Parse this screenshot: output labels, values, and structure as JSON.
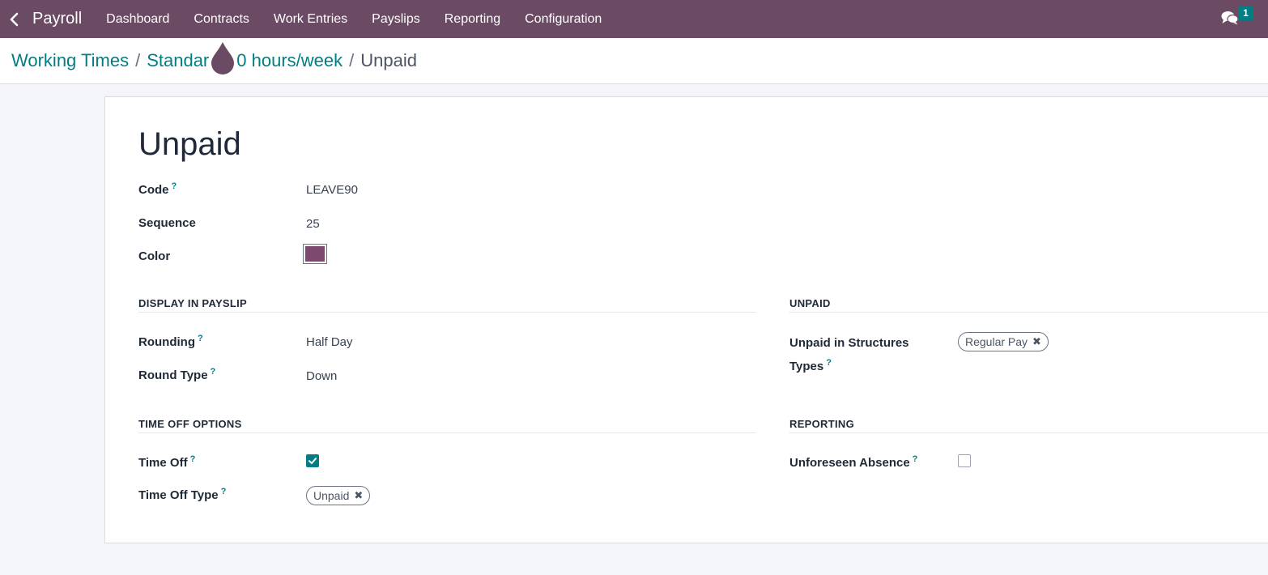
{
  "navbar": {
    "app_title": "Payroll",
    "menu": [
      "Dashboard",
      "Contracts",
      "Work Entries",
      "Payslips",
      "Reporting",
      "Configuration"
    ],
    "chat_badge": "1",
    "colors": {
      "bar": "#6b4a64",
      "badge": "#017e84"
    }
  },
  "breadcrumb": {
    "item1": "Working Times",
    "item2_left": "Standar",
    "item2_right": "0 hours/week",
    "separator": "/",
    "current": "Unpaid"
  },
  "form": {
    "title": "Unpaid",
    "code": {
      "label": "Code",
      "help": "?",
      "value": "LEAVE90"
    },
    "sequence": {
      "label": "Sequence",
      "value": "25"
    },
    "color": {
      "label": "Color",
      "value_hex": "#7c4a6e"
    },
    "display_in_payslip": {
      "title": "DISPLAY IN PAYSLIP",
      "rounding": {
        "label": "Rounding",
        "help": "?",
        "value": "Half Day"
      },
      "round_type": {
        "label": "Round Type",
        "help": "?",
        "value": "Down"
      }
    },
    "unpaid": {
      "title": "UNPAID",
      "structures": {
        "label_line1": "Unpaid in Structures",
        "label_line2": "Types",
        "help": "?",
        "tag": "Regular Pay"
      }
    },
    "time_off_options": {
      "title": "TIME OFF OPTIONS",
      "time_off": {
        "label": "Time Off",
        "help": "?",
        "checked": true
      },
      "time_off_type": {
        "label": "Time Off Type",
        "help": "?",
        "tag": "Unpaid"
      }
    },
    "reporting": {
      "title": "REPORTING",
      "unforeseen": {
        "label": "Unforeseen Absence",
        "help": "?",
        "checked": false
      }
    },
    "tag_remove_glyph": "✖"
  }
}
